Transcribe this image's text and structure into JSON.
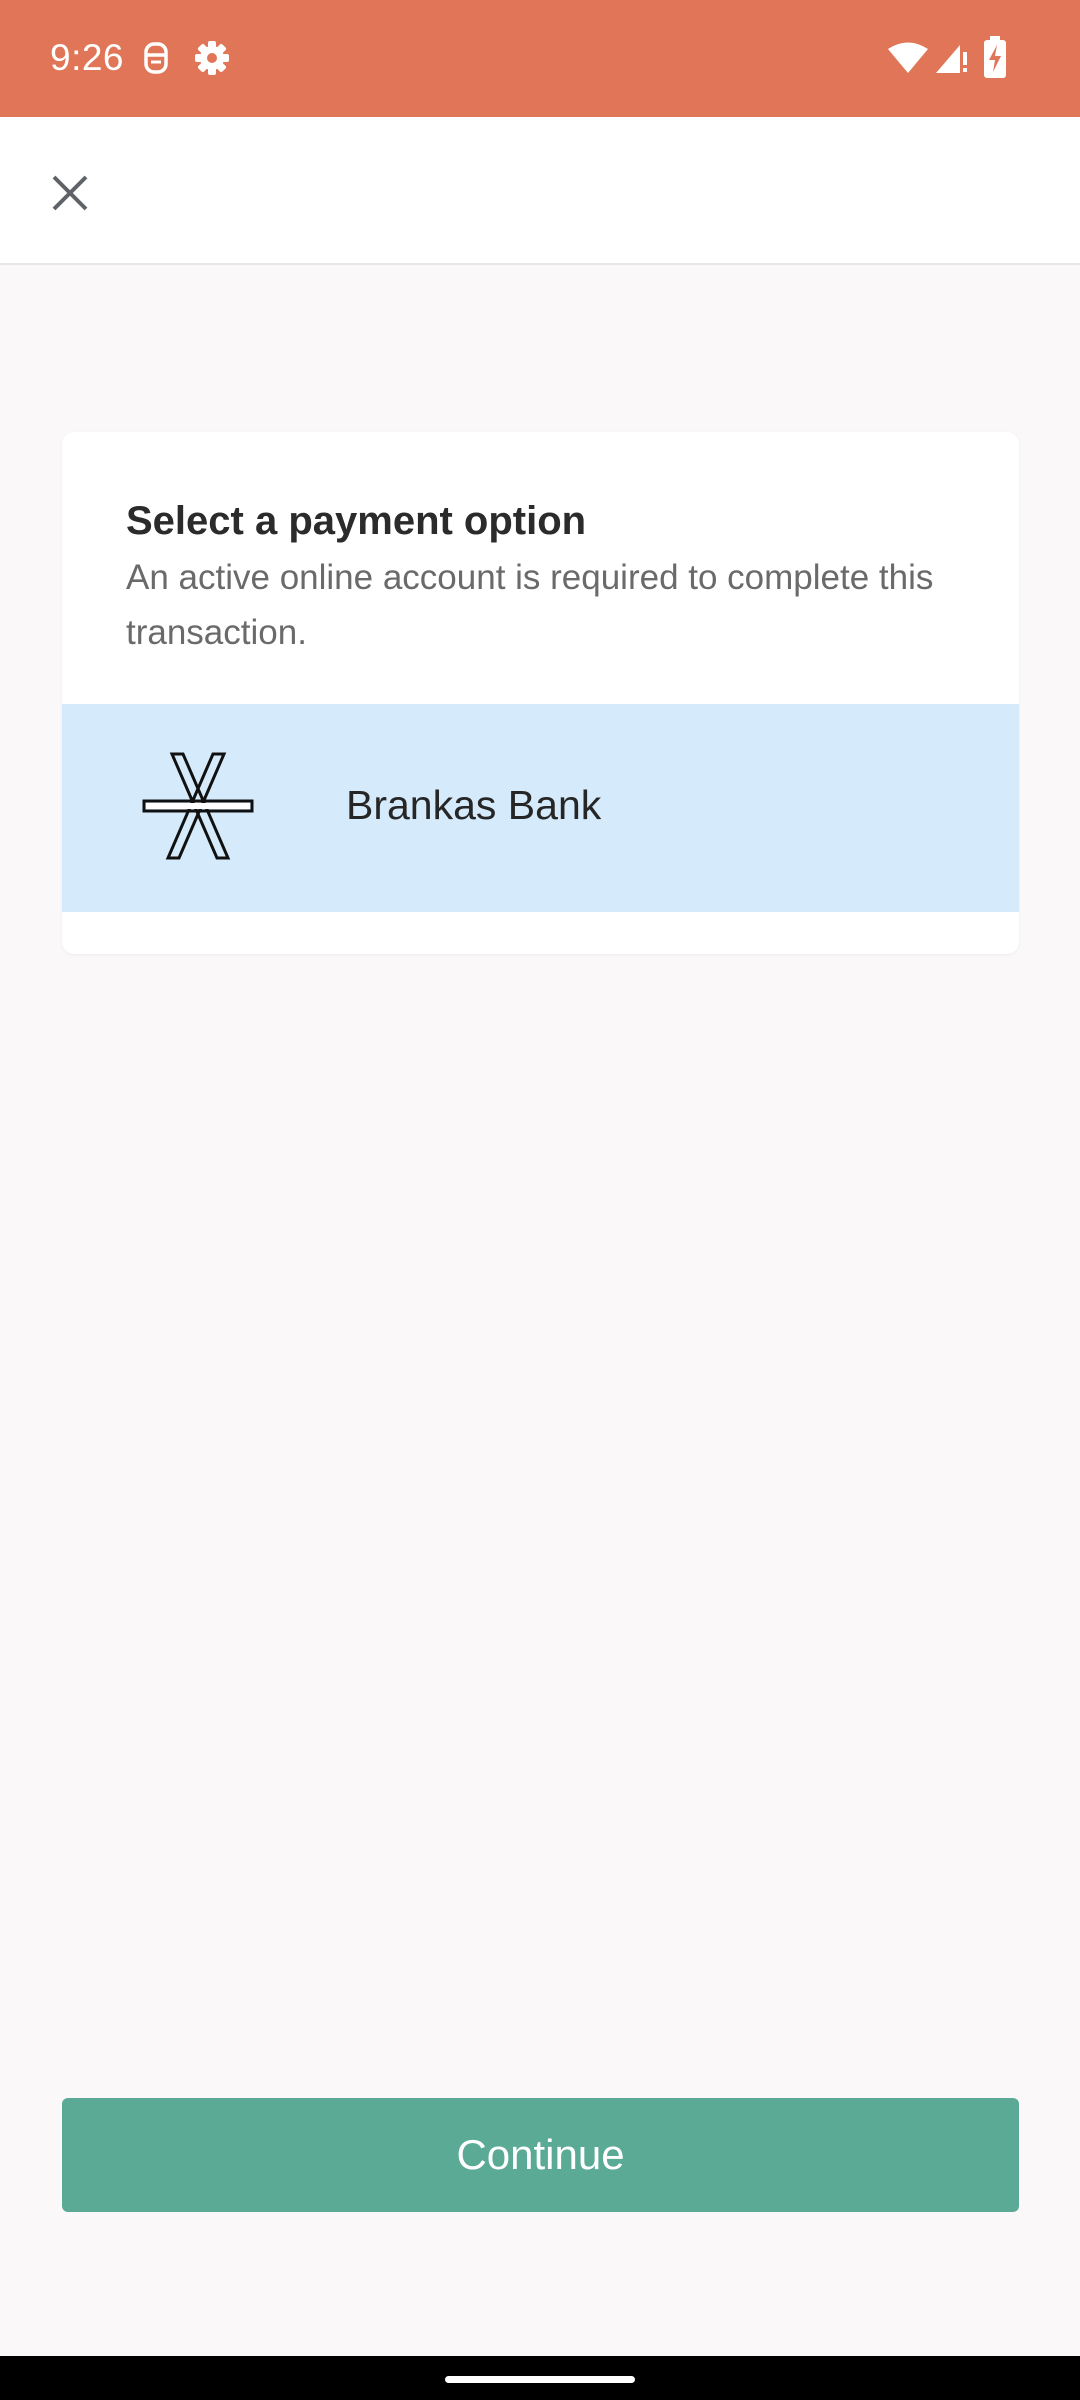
{
  "status_bar": {
    "time": "9:26",
    "background_color": "#e07657",
    "icons": [
      "notification-app-icon",
      "settings-gear-icon",
      "wifi-icon",
      "cell-signal-icon",
      "battery-charging-icon"
    ]
  },
  "header": {
    "close_icon": "close-icon"
  },
  "card": {
    "title": "Select a payment option",
    "subtitle": "An active online account is required to complete this transaction.",
    "options": [
      {
        "name": "Brankas Bank",
        "logo_icon": "brankas-logo-icon",
        "selected": true,
        "highlight_color": "#d5eafa"
      }
    ]
  },
  "footer": {
    "continue_label": "Continue",
    "button_color": "#5aaa96"
  }
}
